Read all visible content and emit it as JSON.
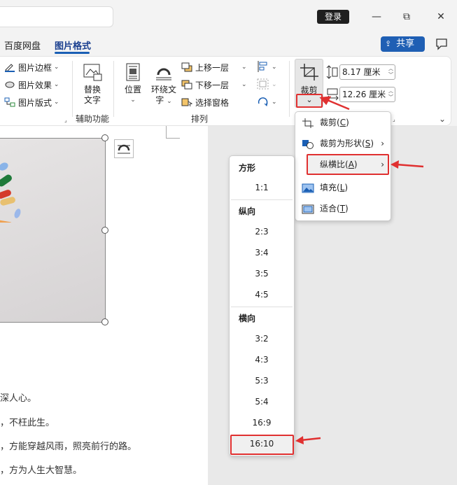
{
  "titlebar": {
    "login_label": "登录",
    "minimize_glyph": "—",
    "restore_glyph": "⧉",
    "close_glyph": "✕"
  },
  "tabs": {
    "items": [
      "百度网盘",
      "图片格式"
    ],
    "active": "图片格式",
    "share_label": "共享"
  },
  "ribbon": {
    "picture_border": "图片边框",
    "picture_effects": "图片效果",
    "picture_layout": "图片版式",
    "alt_text_1": "替换",
    "alt_text_2": "文字",
    "accessibility_group": "辅助功能",
    "position": "位置",
    "wrap_text_1": "环绕文",
    "wrap_text_2": "字",
    "bring_forward": "上移一层",
    "send_backward": "下移一层",
    "selection_pane": "选择窗格",
    "arrange_group": "排列",
    "crop": "裁剪",
    "height_value": "8.17 厘米",
    "width_value": "12.26 厘米"
  },
  "document": {
    "lines": [
      "深人心。",
      "，不枉此生。",
      "，方能穿越风雨，照亮前行的路。",
      "，方为人生大智慧。"
    ]
  },
  "crop_menu": {
    "items": [
      {
        "label": "裁剪(",
        "key": "C",
        "icon": "crop-icon"
      },
      {
        "label": "裁剪为形状(",
        "key": "S",
        "icon": "shape-icon",
        "submenu": true
      },
      {
        "label": "纵横比(",
        "key": "A",
        "icon": "",
        "submenu": true
      },
      {
        "label": "填充(",
        "key": "L",
        "icon": "fill-icon"
      },
      {
        "label": "适合(",
        "key": "T",
        "icon": "fit-icon"
      }
    ]
  },
  "aspect_menu": {
    "square_header": "方形",
    "square": [
      "1:1"
    ],
    "portrait_header": "纵向",
    "portrait": [
      "2:3",
      "3:4",
      "3:5",
      "4:5"
    ],
    "landscape_header": "横向",
    "landscape": [
      "3:2",
      "4:3",
      "5:3",
      "5:4",
      "16:9",
      "16:10"
    ],
    "selected": "16:10"
  },
  "colors": {
    "accent": "#1a5fb4",
    "highlight_border": "#e03030"
  }
}
